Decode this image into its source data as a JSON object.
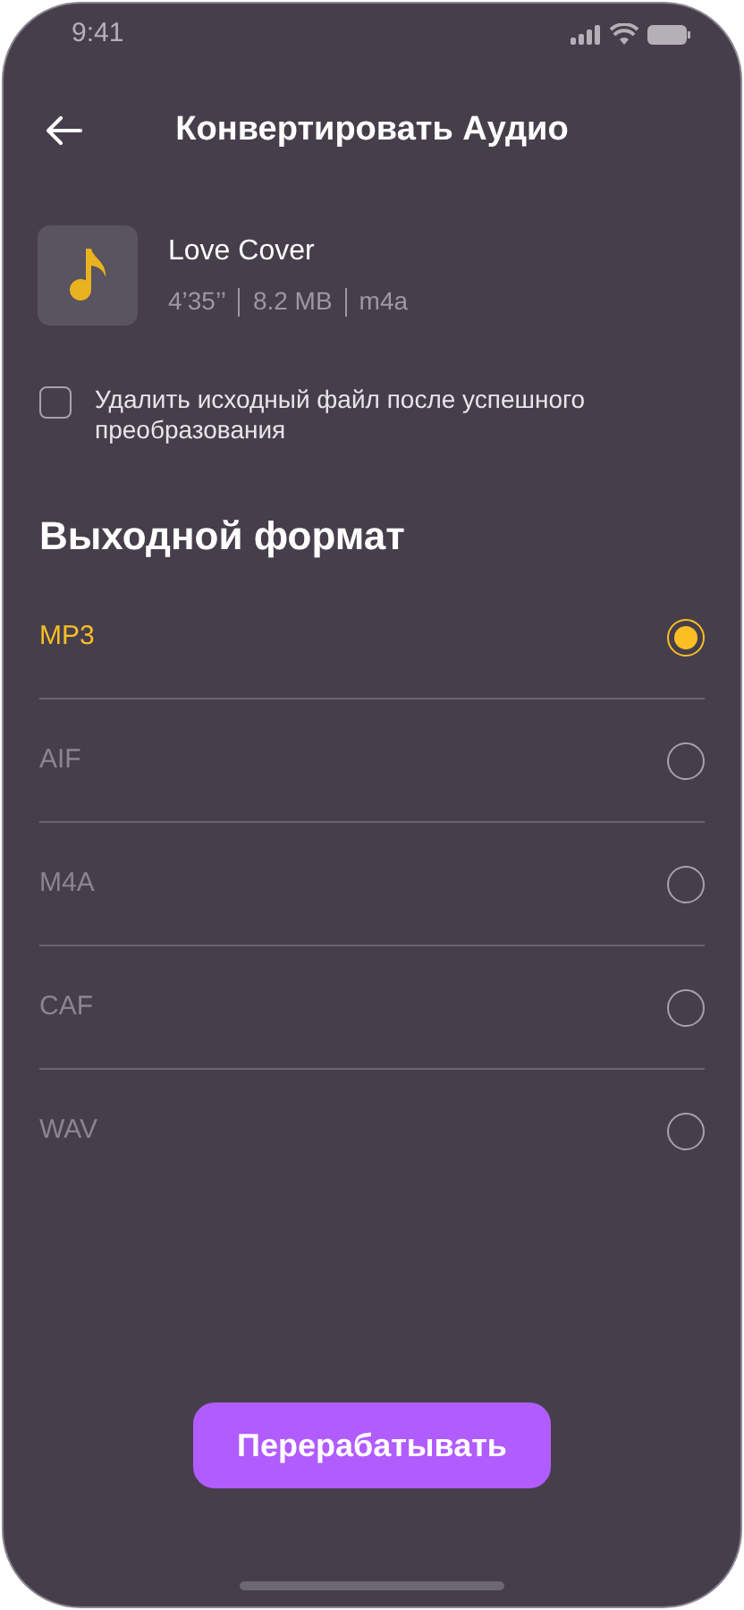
{
  "status_bar": {
    "time": "9:41"
  },
  "header": {
    "title": "Конвертировать Аудио"
  },
  "file": {
    "name": "Love Cover",
    "meta": [
      "4’35’’",
      "8.2 MB",
      "m4a"
    ]
  },
  "delete_option": {
    "label": "Удалить исходный файл после успешного преобразования",
    "checked": false
  },
  "section_title": "Выходной формат",
  "formats": [
    {
      "label": "MP3",
      "selected": true
    },
    {
      "label": "AIF",
      "selected": false
    },
    {
      "label": "M4A",
      "selected": false
    },
    {
      "label": "CAF",
      "selected": false
    },
    {
      "label": "WAV",
      "selected": false
    }
  ],
  "primary_button": "Перерабатывать"
}
